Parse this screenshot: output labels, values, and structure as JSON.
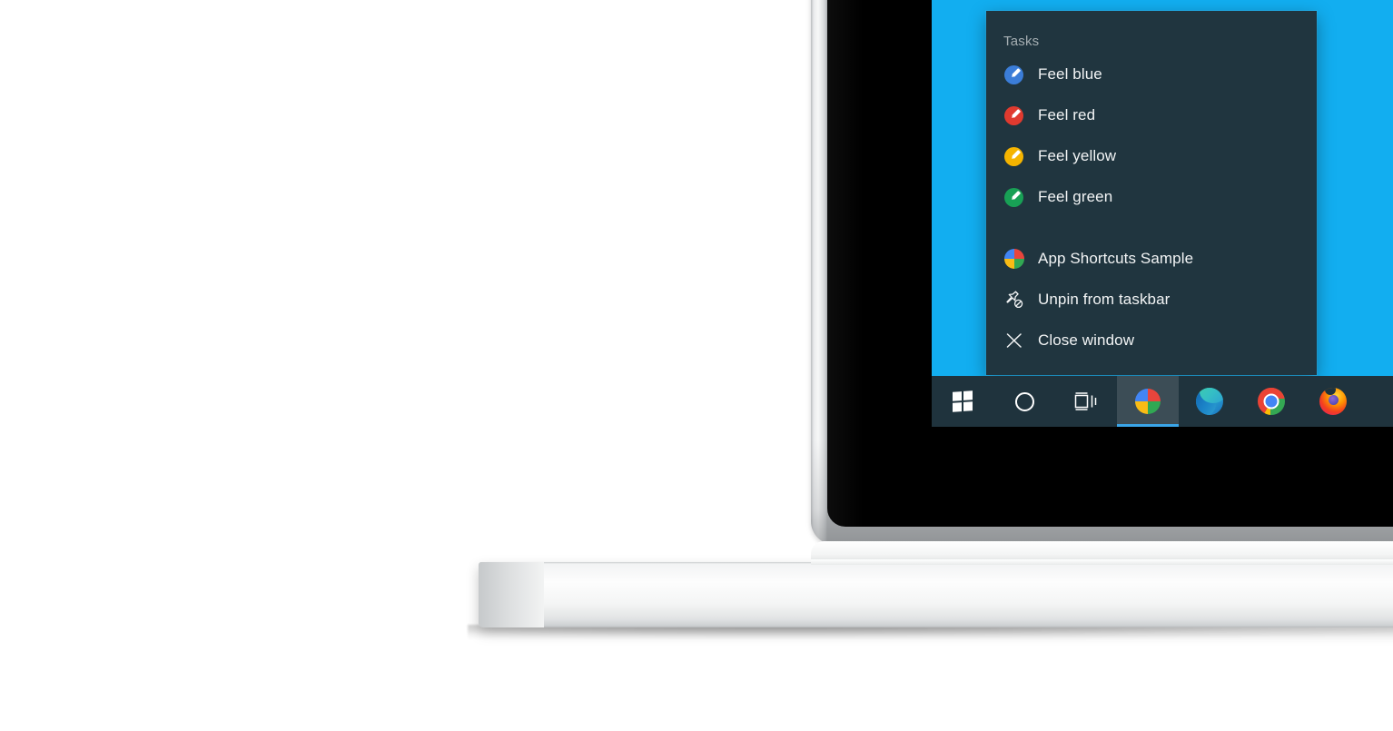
{
  "scene": {
    "description": "laptop-product-shot",
    "background_color": "#ffffff",
    "device": "laptop",
    "bezel_color": "#000000",
    "chassis_color": "#f2f3f4"
  },
  "display": {
    "wallpaper_color": "#12aef0",
    "os": "windows-10"
  },
  "jumplist": {
    "header": "Tasks",
    "background_color": "#20353f",
    "tasks": [
      {
        "label": "Feel blue",
        "icon": "brush-circle-icon",
        "color": "#3b7dd8"
      },
      {
        "label": "Feel red",
        "icon": "brush-circle-icon",
        "color": "#e03a2f"
      },
      {
        "label": "Feel yellow",
        "icon": "brush-circle-icon",
        "color": "#f5b400"
      },
      {
        "label": "Feel green",
        "icon": "brush-circle-icon",
        "color": "#18a055"
      }
    ],
    "actions": [
      {
        "label": "App Shortcuts Sample",
        "icon": "app-pie-icon"
      },
      {
        "label": "Unpin from taskbar",
        "icon": "unpin-icon"
      },
      {
        "label": "Close window",
        "icon": "close-icon"
      }
    ]
  },
  "taskbar": {
    "background_color": "#1f333d",
    "accent_color": "#3aa5e8",
    "buttons": [
      {
        "name": "start",
        "icon": "windows-logo-icon",
        "label": "Start",
        "active": false
      },
      {
        "name": "cortana",
        "icon": "cortana-circle-icon",
        "label": "Cortana",
        "active": false
      },
      {
        "name": "task-view",
        "icon": "task-view-icon",
        "label": "Task View",
        "active": false
      }
    ],
    "apps": [
      {
        "name": "app-shortcuts-sample",
        "icon": "app-pie-icon",
        "label": "App Shortcuts Sample",
        "active": true
      },
      {
        "name": "microsoft-edge",
        "icon": "edge-icon",
        "label": "Microsoft Edge",
        "active": false
      },
      {
        "name": "google-chrome",
        "icon": "chrome-icon",
        "label": "Google Chrome",
        "active": false
      },
      {
        "name": "mozilla-firefox",
        "icon": "firefox-icon",
        "label": "Mozilla Firefox",
        "active": false
      }
    ]
  },
  "pie_icon": {
    "quadrants": [
      {
        "position": "top-left",
        "color": "#4285f4"
      },
      {
        "position": "top-right",
        "color": "#e8453c"
      },
      {
        "position": "bottom-left",
        "color": "#f9bc15"
      },
      {
        "position": "bottom-right",
        "color": "#31a853"
      }
    ]
  }
}
